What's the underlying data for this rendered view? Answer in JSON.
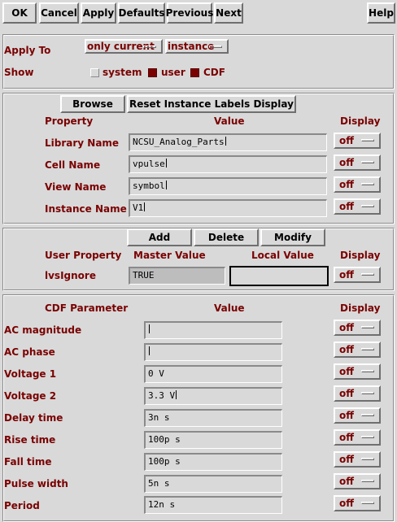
{
  "toolbar": {
    "ok": "OK",
    "cancel": "Cancel",
    "apply": "Apply",
    "defaults": "Defaults",
    "previous": "Previous",
    "next": "Next",
    "help": "Help"
  },
  "apply_section": {
    "apply_to_label": "Apply To",
    "apply_to_scope": "only current",
    "apply_to_target": "instance",
    "show_label": "Show",
    "show_options": [
      {
        "label": "system",
        "checked": false
      },
      {
        "label": "user",
        "checked": true
      },
      {
        "label": "CDF",
        "checked": true
      }
    ]
  },
  "instance_section": {
    "browse": "Browse",
    "reset": "Reset Instance Labels Display",
    "col_property": "Property",
    "col_value": "Value",
    "col_display": "Display",
    "rows": [
      {
        "label": "Library Name",
        "value": "NCSU_Analog_Parts",
        "display": "off"
      },
      {
        "label": "Cell Name",
        "value": "vpulse",
        "display": "off"
      },
      {
        "label": "View Name",
        "value": "symbol",
        "display": "off"
      },
      {
        "label": "Instance Name",
        "value": "V1",
        "display": "off"
      }
    ]
  },
  "user_section": {
    "add": "Add",
    "delete": "Delete",
    "modify": "Modify",
    "col_user_property": "User Property",
    "col_master_value": "Master Value",
    "col_local_value": "Local Value",
    "col_display": "Display",
    "rows": [
      {
        "label": "lvsIgnore",
        "master": "TRUE",
        "local": "",
        "display": "off"
      }
    ]
  },
  "cdf_section": {
    "col_param": "CDF Parameter",
    "col_value": "Value",
    "col_display": "Display",
    "rows": [
      {
        "label": "AC magnitude",
        "value": "",
        "display": "off"
      },
      {
        "label": "AC phase",
        "value": "",
        "display": "off"
      },
      {
        "label": "Voltage 1",
        "value": "0 V",
        "display": "off"
      },
      {
        "label": "Voltage 2",
        "value": "3.3 V",
        "display": "off"
      },
      {
        "label": "Delay time",
        "value": "3n s",
        "display": "off"
      },
      {
        "label": "Rise time",
        "value": "100p s",
        "display": "off"
      },
      {
        "label": "Fall time",
        "value": "100p s",
        "display": "off"
      },
      {
        "label": "Pulse width",
        "value": "5n s",
        "display": "off"
      },
      {
        "label": "Period",
        "value": "12n s",
        "display": "off"
      }
    ]
  },
  "colors": {
    "label": "#7a0000",
    "background": "#d9d9d9",
    "checked": "#7a0000"
  }
}
